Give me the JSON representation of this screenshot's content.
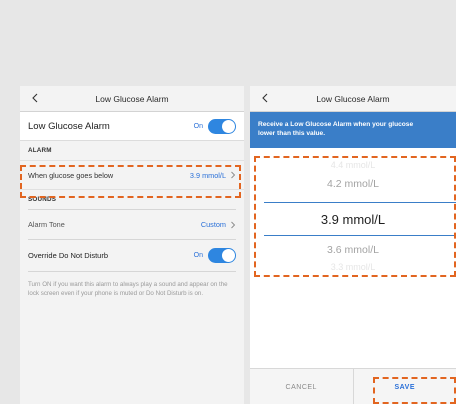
{
  "left_screen": {
    "nav_title": "Low Glucose Alarm",
    "alarm_row": {
      "label": "Low Glucose Alarm",
      "toggle_state": "On"
    },
    "alarm_section": {
      "heading": "ALARM",
      "glucose_row_label": "When glucose goes below",
      "glucose_row_value": "3.9 mmol/L"
    },
    "sounds_section": {
      "heading": "SOUNDS",
      "tone_label": "Alarm Tone",
      "tone_value": "Custom"
    },
    "override_row": {
      "label": "Override Do Not Disturb",
      "toggle_state": "On"
    },
    "help_text": "Turn ON if you want this alarm to always play a sound and appear on the lock screen even if your phone is muted or Do Not Disturb is on."
  },
  "right_screen": {
    "nav_title": "Low Glucose Alarm",
    "banner_line1": "Receive a Low Glucose Alarm when your glucose",
    "banner_line2": "lower than this value.",
    "picker": {
      "far_above": "4.4 mmol/L",
      "above": "4.2 mmol/L",
      "selected": "3.9 mmol/L",
      "below": "3.6 mmol/L",
      "far_below": "3.3 mmol/L"
    },
    "cancel_label": "CANCEL",
    "save_label": "SAVE"
  },
  "colors": {
    "accent_blue": "#2a70d8",
    "banner_blue": "#3a7ec8",
    "toggle_blue": "#2e86e0",
    "highlight_orange": "#e26520"
  },
  "icons": {
    "back": "chevron-left-icon",
    "disclosure": "chevron-right-icon"
  }
}
